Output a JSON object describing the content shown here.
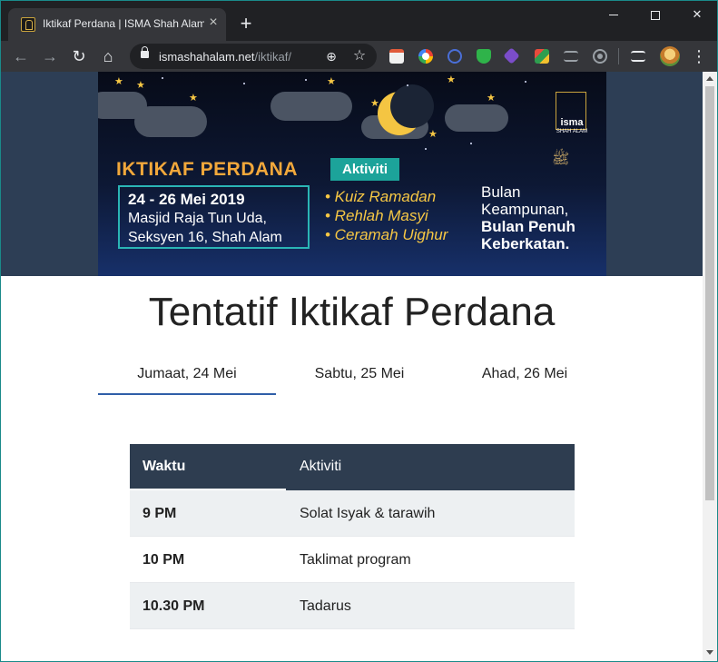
{
  "browser": {
    "tab_title": "Iktikaf Perdana | ISMA Shah Alam",
    "url_host": "ismashahalam.net",
    "url_path": "/iktikaf/"
  },
  "banner": {
    "title": "IKTIKAF PERDANA",
    "date": "24 - 26 Mei 2019",
    "location_line1": "Masjid Raja Tun Uda,",
    "location_line2": "Seksyen 16, Shah Alam",
    "aktiviti_label": "Aktiviti",
    "activities": [
      "• Kuiz Ramadan",
      "• Rehlah Masyi",
      "• Ceramah Uighur"
    ],
    "slogan_line1": "Bulan",
    "slogan_line2": "Keampunan,",
    "slogan_line3": "Bulan Penuh",
    "slogan_line4": "Keberkatan.",
    "logo_text": "isma",
    "logo_sub": "SHAH ALAM"
  },
  "page": {
    "title": "Tentatif Iktikaf Perdana",
    "day_tabs": [
      "Jumaat, 24 Mei",
      "Sabtu, 25 Mei",
      "Ahad, 26 Mei"
    ]
  },
  "schedule": {
    "headers": [
      "Waktu",
      "Aktiviti"
    ],
    "rows": [
      {
        "time": "9 PM",
        "activity": "Solat Isyak & tarawih"
      },
      {
        "time": "10 PM",
        "activity": "Taklimat program"
      },
      {
        "time": "10.30 PM",
        "activity": "Tadarus"
      }
    ]
  },
  "colors": {
    "header_bg": "#2e3d50",
    "tab_indicator": "#2f5ea8",
    "accent_gold": "#f2a83b",
    "accent_teal": "#1ca39a"
  }
}
